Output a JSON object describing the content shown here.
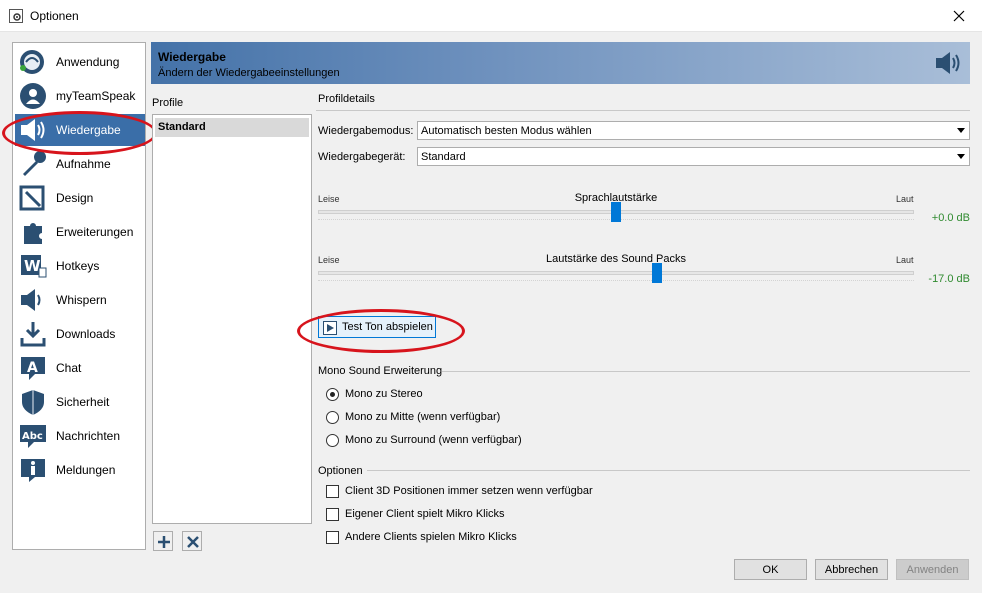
{
  "window": {
    "title": "Optionen",
    "close_icon": "close-icon"
  },
  "nav": {
    "selected": "Wiedergabe",
    "items": [
      {
        "label": "Anwendung",
        "icon": "teamspeak-logo-icon"
      },
      {
        "label": "myTeamSpeak",
        "icon": "user-account-icon"
      },
      {
        "label": "Wiedergabe",
        "icon": "speaker-icon"
      },
      {
        "label": "Aufnahme",
        "icon": "microphone-icon"
      },
      {
        "label": "Design",
        "icon": "design-icon"
      },
      {
        "label": "Erweiterungen",
        "icon": "puzzle-icon"
      },
      {
        "label": "Hotkeys",
        "icon": "hotkeys-icon"
      },
      {
        "label": "Whispern",
        "icon": "whisper-icon"
      },
      {
        "label": "Downloads",
        "icon": "download-icon"
      },
      {
        "label": "Chat",
        "icon": "chat-icon"
      },
      {
        "label": "Sicherheit",
        "icon": "shield-icon"
      },
      {
        "label": "Nachrichten",
        "icon": "messages-icon"
      },
      {
        "label": "Meldungen",
        "icon": "info-icon"
      }
    ]
  },
  "header": {
    "title": "Wiedergabe",
    "subtitle": "Ändern der Wiedergabeeinstellungen"
  },
  "profiles": {
    "label": "Profile",
    "items": [
      "Standard"
    ],
    "selected": "Standard"
  },
  "details": {
    "label": "Profildetails",
    "mode_label": "Wiedergabemodus:",
    "mode_value": "Automatisch besten Modus wählen",
    "device_label": "Wiedergabegerät:",
    "device_value": "Standard",
    "voice_slider": {
      "low": "Leise",
      "title": "Sprachlautstärke",
      "high": "Laut",
      "value_text": "+0.0 dB",
      "position_fraction": 0.5
    },
    "soundpack_slider": {
      "low": "Leise",
      "title": "Lautstärke des Sound Packs",
      "high": "Laut",
      "value_text": "-17.0 dB",
      "position_fraction": 0.57
    },
    "test_button": "Test Ton abspielen"
  },
  "mono": {
    "title": "Mono Sound Erweiterung",
    "options": [
      "Mono zu Stereo",
      "Mono zu Mitte (wenn verfügbar)",
      "Mono zu Surround (wenn verfügbar)"
    ],
    "selected_index": 0
  },
  "options": {
    "title": "Optionen",
    "checkboxes": [
      {
        "label": "Client 3D Positionen immer setzen wenn verfügbar",
        "checked": false
      },
      {
        "label": "Eigener Client spielt Mikro Klicks",
        "checked": false
      },
      {
        "label": "Andere Clients spielen Mikro Klicks",
        "checked": false
      }
    ]
  },
  "buttons": {
    "ok": "OK",
    "cancel": "Abbrechen",
    "apply": "Anwenden"
  },
  "colors": {
    "selection": "#3a6ea8",
    "slider_thumb": "#0078d7",
    "db_text": "#2f8a2f",
    "annotation_ring": "#d7141c"
  }
}
